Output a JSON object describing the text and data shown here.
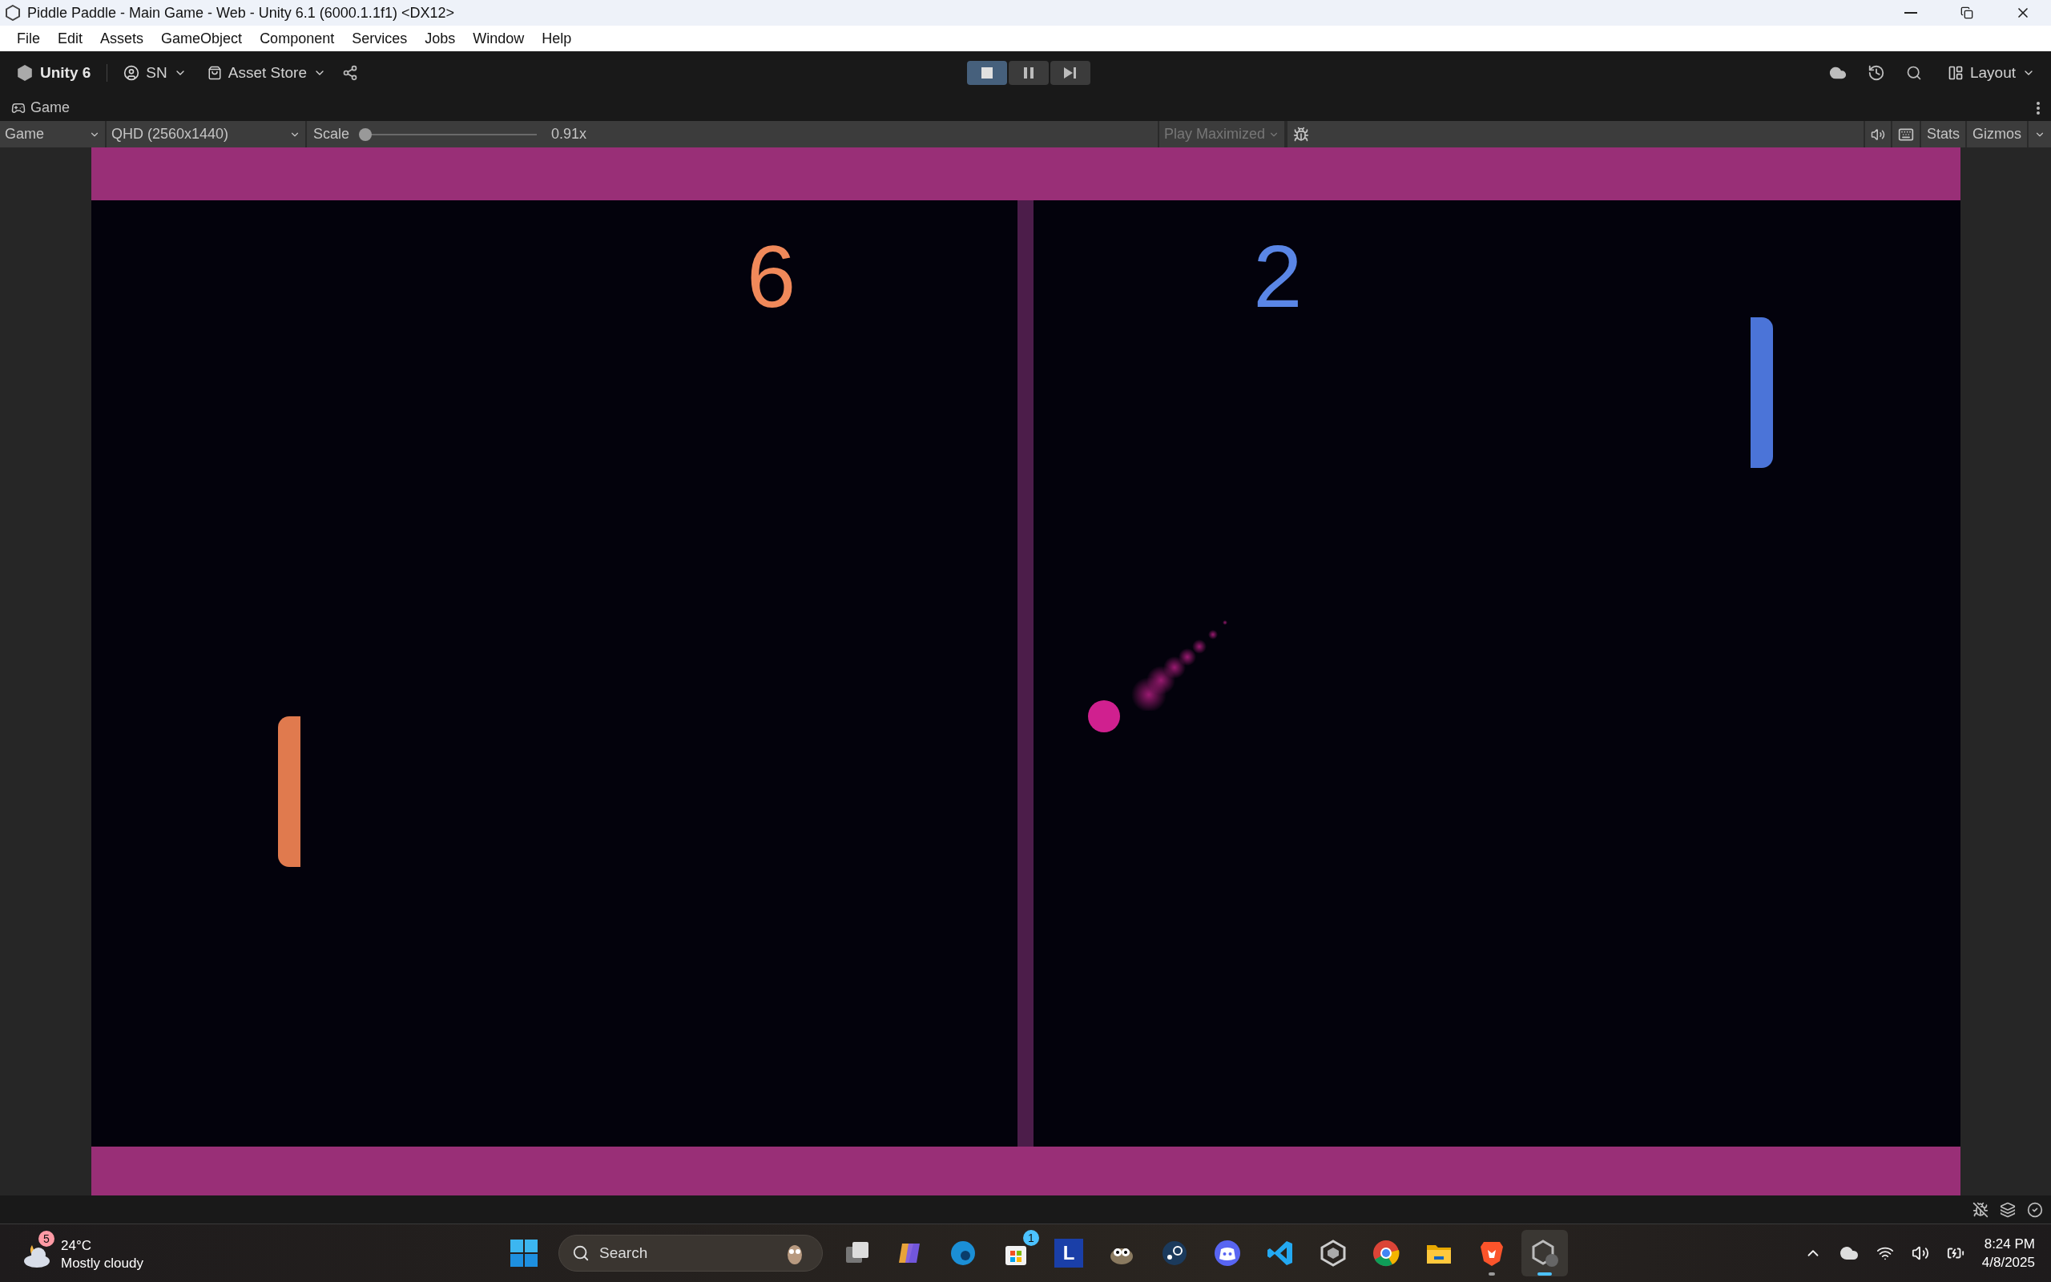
{
  "window": {
    "title": "Piddle Paddle - Main Game - Web - Unity 6.1 (6000.1.1f1) <DX12>"
  },
  "menu": [
    "File",
    "Edit",
    "Assets",
    "GameObject",
    "Component",
    "Services",
    "Jobs",
    "Window",
    "Help"
  ],
  "toolbar": {
    "product": "Unity 6",
    "account": "SN",
    "store": "Asset Store",
    "layout": "Layout",
    "controls": [
      {
        "kind": "play",
        "selected": true
      },
      {
        "kind": "pause",
        "selected": false
      },
      {
        "kind": "step",
        "selected": false
      }
    ]
  },
  "game_tab": {
    "label": "Game"
  },
  "game_toolbar": {
    "display": "Game",
    "resolution": "QHD (2560x1440)",
    "scale_label": "Scale",
    "scale": {
      "level": 0.01,
      "reading": "0.91x"
    },
    "play_mode": "Play Maximized",
    "stats": "Stats",
    "gizmos": "Gizmos"
  },
  "game": {
    "scores": [
      {
        "value": "6",
        "color": "#f0895a"
      },
      {
        "value": "2",
        "color": "#5a86e6"
      }
    ],
    "paddles": [
      {
        "kind": "left",
        "color": "#e07a4e"
      },
      {
        "kind": "right",
        "color": "#4b74d8"
      }
    ]
  },
  "taskbar": {
    "weather": {
      "badge": "5",
      "temperature": "24°C",
      "condition": "Mostly cloudy"
    },
    "search": {
      "placeholder": "Search"
    },
    "apps": [
      {
        "kind": "taskview",
        "selected": false,
        "running": false
      },
      {
        "kind": "copilot",
        "selected": false,
        "running": false
      },
      {
        "kind": "edge",
        "selected": false,
        "running": false
      },
      {
        "kind": "store",
        "selected": false,
        "running": false,
        "badge": "1"
      },
      {
        "kind": "letter",
        "selected": false,
        "running": false,
        "letter": "L"
      },
      {
        "kind": "gimp",
        "selected": false,
        "running": false
      },
      {
        "kind": "steam",
        "selected": false,
        "running": false
      },
      {
        "kind": "discord",
        "selected": false,
        "running": false
      },
      {
        "kind": "vscode",
        "selected": false,
        "running": false
      },
      {
        "kind": "unityhub",
        "selected": false,
        "running": false
      },
      {
        "kind": "chrome",
        "selected": false,
        "running": false
      },
      {
        "kind": "folder",
        "selected": false,
        "running": false
      },
      {
        "kind": "brave",
        "selected": false,
        "running": true
      },
      {
        "kind": "unity",
        "selected": true,
        "running": true
      }
    ],
    "time": "8:24 PM",
    "date": "4/8/2025"
  }
}
